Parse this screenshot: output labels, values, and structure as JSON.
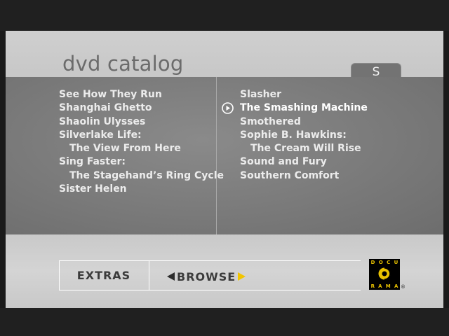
{
  "header": {
    "title": "dvd catalog",
    "current_letter_tab": "S"
  },
  "catalog": {
    "left_column": [
      {
        "label": "See How They Run",
        "indent": false
      },
      {
        "label": "Shanghai Ghetto",
        "indent": false
      },
      {
        "label": "Shaolin Ulysses",
        "indent": false
      },
      {
        "label": "Silverlake Life:",
        "indent": false
      },
      {
        "label": "The View From Here",
        "indent": true
      },
      {
        "label": "Sing Faster:",
        "indent": false
      },
      {
        "label": "The Stagehand’s Ring Cycle",
        "indent": true
      },
      {
        "label": "Sister Helen",
        "indent": false
      }
    ],
    "right_column": [
      {
        "label": "Slasher",
        "indent": false
      },
      {
        "label": "The Smashing Machine",
        "indent": false,
        "selected": true
      },
      {
        "label": "Smothered",
        "indent": false
      },
      {
        "label": "Sophie B. Hawkins:",
        "indent": false
      },
      {
        "label": "The Cream Will Rise",
        "indent": true
      },
      {
        "label": "Sound and Fury",
        "indent": false
      },
      {
        "label": "Southern Comfort",
        "indent": false
      }
    ]
  },
  "nav": {
    "extras_label": "EXTRAS",
    "browse_label": "BROWSE",
    "browse_prev_icon": "left-triangle-arrow",
    "browse_next_icon": "right-triangle-arrow"
  },
  "logo": {
    "top_letters": [
      "D",
      "O",
      "C",
      "U"
    ],
    "bottom_letters": [
      "R",
      "A",
      "M",
      "A"
    ],
    "registered_mark": "®"
  },
  "colors": {
    "accent": "#f2c500",
    "panel_gray": "#7a7a7a",
    "band_gray": "#c8c8c8",
    "text_light": "#ececec",
    "nav_text": "#3b3b3b"
  }
}
